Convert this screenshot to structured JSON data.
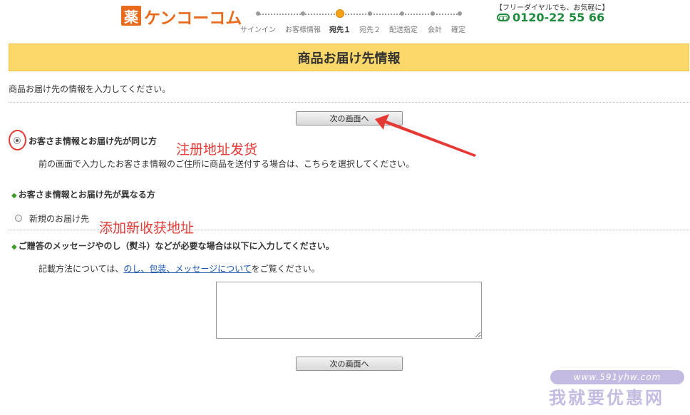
{
  "header": {
    "logo_mark": "薬",
    "logo_text": "ケンコーコム",
    "steps": [
      {
        "label": "サインイン",
        "active": false
      },
      {
        "label": "お客様情報",
        "active": false
      },
      {
        "label": "宛先１",
        "active": true
      },
      {
        "label": "宛先２",
        "active": false
      },
      {
        "label": "配送指定",
        "active": false
      },
      {
        "label": "会計",
        "active": false
      },
      {
        "label": "確定",
        "active": false
      }
    ],
    "free_dial_label": "【フリーダイヤルでも、お気軽に】",
    "phone": "0120-22 55 66"
  },
  "page": {
    "title": "商品お届け先情報",
    "intro": "商品お届け先の情報を入力してください。",
    "next_button_top": "次の画面へ",
    "next_button_bottom": "次の画面へ"
  },
  "options": {
    "same_address_label": "お客さま情報とお届け先が同じ方",
    "same_address_desc": "前の画面で入力したお客さま情報のご住所に商品を送付する場合は、こちらを選択してください。",
    "different_heading": "お客さま情報とお届け先が異なる方",
    "new_address_label": "新規のお届け先"
  },
  "gift": {
    "heading": "ご贈答のメッセージやのし（熨斗）などが必要な場合は以下に入力してください。",
    "note_prefix": "記載方法については、",
    "note_link": "のし、包装、メッセージについて",
    "note_suffix": "をご覧ください。",
    "message_value": ""
  },
  "annotations": {
    "register_address": "注册地址发货",
    "add_new_address": "添加新收获地址"
  },
  "watermark": {
    "url": "www.591yhw.com",
    "name": "我就要优惠网"
  },
  "colors": {
    "brand_orange": "#e86a1c",
    "title_yellow": "#fcd86a",
    "phone_green": "#1e8a3b",
    "annotation_red": "#e53935",
    "link_blue": "#1a56b0"
  }
}
